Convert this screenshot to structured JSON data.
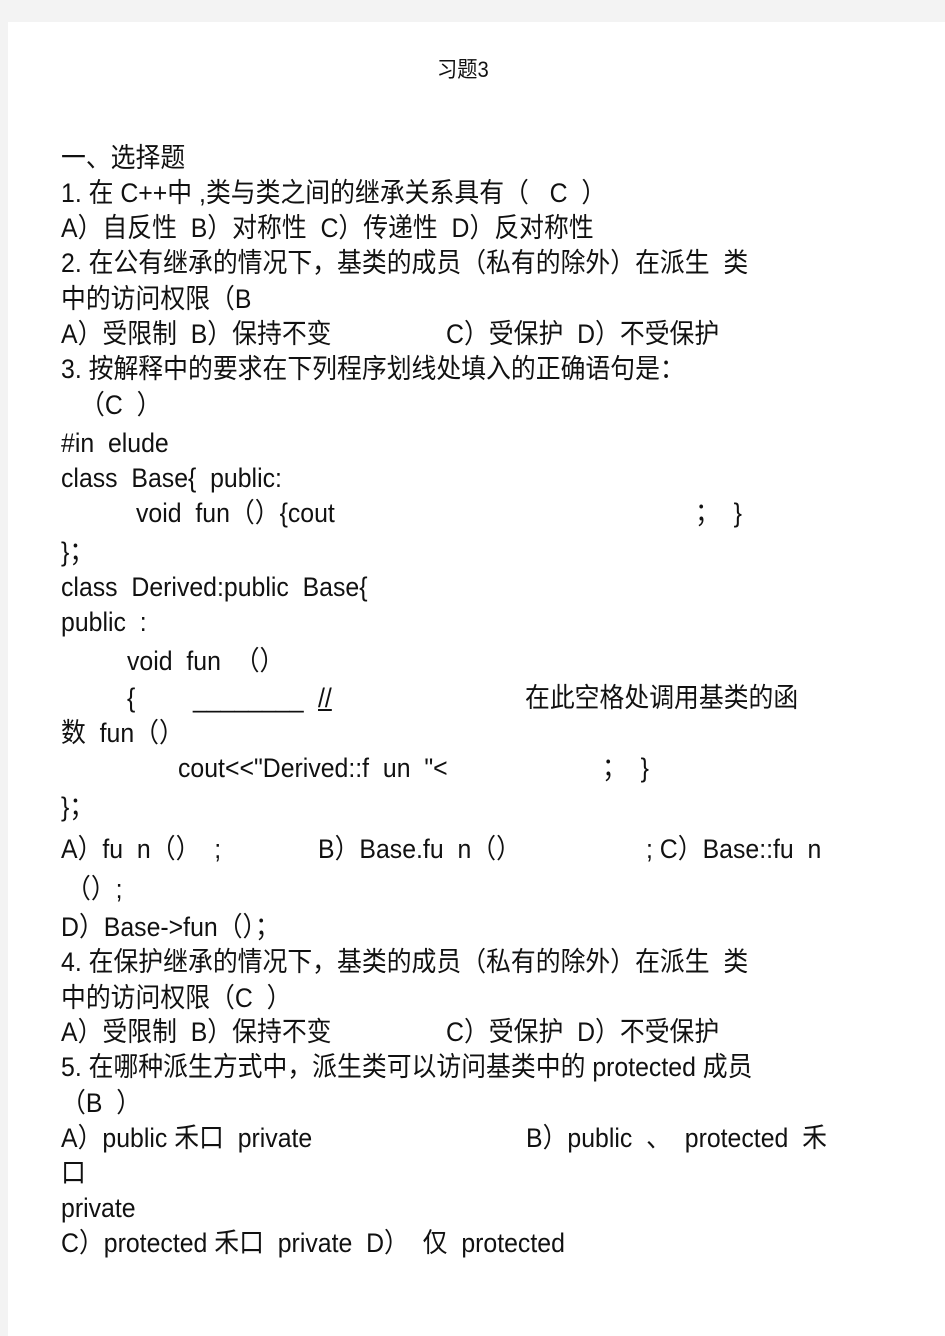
{
  "title": "习题3",
  "section": "一、选择题",
  "q1": {
    "stem": "1. 在 C++中 ,类与类之间的继承关系具有（   C  ）",
    "options": "A）自反性  B）对称性  C）传递性  D）反对称性"
  },
  "q2": {
    "stem_line1": "2. 在公有继承的情况下，基类的成员（私有的除外）在派生  类",
    "stem_line2": "中的访问权限（B",
    "option_ab": "A）受限制  B）保持不变",
    "option_cd": "C）受保护  D）不受保护"
  },
  "q3": {
    "stem_line1": "3. 按解释中的要求在下列程序划线处填入的正确语句是：",
    "stem_line2": "（C  ）",
    "code": {
      "l1": "#in  elude",
      "l2": "class  Base{  public:",
      "l3_left": "void  fun（）{cout",
      "l3_right": "；  }",
      "l4": "}；",
      "l5": "class  Derived:public  Base{",
      "l6": "public  :",
      "l7": "void  fun  （）",
      "l8_brace": "{",
      "l8_blank": "________",
      "l8_comment": "//",
      "l8_note": "在此空格处调用基类的函",
      "l9": "数  fun（）",
      "l10_left": "cout<<\"Derived::f  un  \"<",
      "l10_right": "；  }",
      "l11": "}；"
    },
    "option_a": "A）fu  n（）  ;",
    "option_b": "B）Base.fu  n（）",
    "option_c": "; C）Base::fu  n",
    "option_c_cont": "（）;",
    "option_d": "D）Base->fun（）；"
  },
  "q4": {
    "stem_line1": "4. 在保护继承的情况下，基类的成员（私有的除外）在派生  类",
    "stem_line2": "中的访问权限（C  ）",
    "option_ab": "A）受限制  B）保持不变",
    "option_cd": "C）受保护  D）不受保护"
  },
  "q5": {
    "stem_line1": "5. 在哪种派生方式中，派生类可以访问基类中的 protected 成员",
    "stem_line2": "（B  ）",
    "option_a": "A）public 禾口  private",
    "option_b": "B）public  、  protected  禾",
    "option_b_cont1": "口",
    "option_b_cont2": "private",
    "option_cd": "C）protected 禾口  private  D）  仅  protected"
  }
}
